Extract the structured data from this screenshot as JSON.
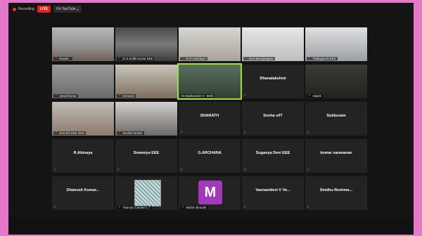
{
  "topbar": {
    "recording_label": "Recording",
    "live_label": "LIVE",
    "stream_label": "On YouTube"
  },
  "tiles": [
    {
      "name": "Raamk...",
      "type": "video",
      "muted": true
    },
    {
      "name": "Dr.S.Sridhi Kumar EEE",
      "type": "video",
      "muted": true
    },
    {
      "name": "Dr.R.Karthikam",
      "type": "video",
      "muted": true
    },
    {
      "name": "Devi Manojkappan",
      "type": "video",
      "muted": true
    },
    {
      "name": "Thaliagavelu EEE",
      "type": "video",
      "muted": true
    },
    {
      "name": "ramalt kumar",
      "type": "video",
      "muted": true
    },
    {
      "name": "Kumaran",
      "type": "video",
      "muted": true
    },
    {
      "name": "Dr.Manikandan S - IEEE",
      "type": "video",
      "muted": false,
      "active": true
    },
    {
      "name": "Dhanalakshmi",
      "type": "name",
      "muted": true
    },
    {
      "name": "rukpek",
      "type": "video",
      "muted": true
    },
    {
      "name": "DHILIPA EEE 2022",
      "type": "video",
      "muted": true
    },
    {
      "name": "Seethal M.EEE",
      "type": "video",
      "muted": true
    },
    {
      "name": "SHARATH",
      "type": "name",
      "muted": true
    },
    {
      "name": "Sneha v/IT",
      "type": "name",
      "muted": true
    },
    {
      "name": "Subburam",
      "type": "name",
      "muted": true
    },
    {
      "name": "R.Abinaya",
      "type": "name",
      "muted": true
    },
    {
      "name": "Sowmiya EEE",
      "type": "name",
      "muted": true
    },
    {
      "name": "G.ARCHANA",
      "type": "name",
      "muted": true
    },
    {
      "name": "Suganya Devi EEE",
      "type": "name",
      "muted": true
    },
    {
      "name": "kumar saravanan",
      "type": "name",
      "muted": true
    },
    {
      "name": "Dhanush Kumar...",
      "type": "name",
      "muted": true
    },
    {
      "name": "Thanusu Canaes C.T",
      "type": "picture",
      "muted": true
    },
    {
      "name": "Mitchin Bharath",
      "type": "avatar",
      "initial": "M",
      "muted": true
    },
    {
      "name": "Vasnavidevi V Ve...",
      "type": "name",
      "muted": true
    },
    {
      "name": "Sindhu Reshma...",
      "type": "name",
      "muted": true
    }
  ],
  "colors": {
    "active_border": "#9ae33a",
    "mute": "#e03333",
    "avatar_bg": "#a23ab8"
  }
}
